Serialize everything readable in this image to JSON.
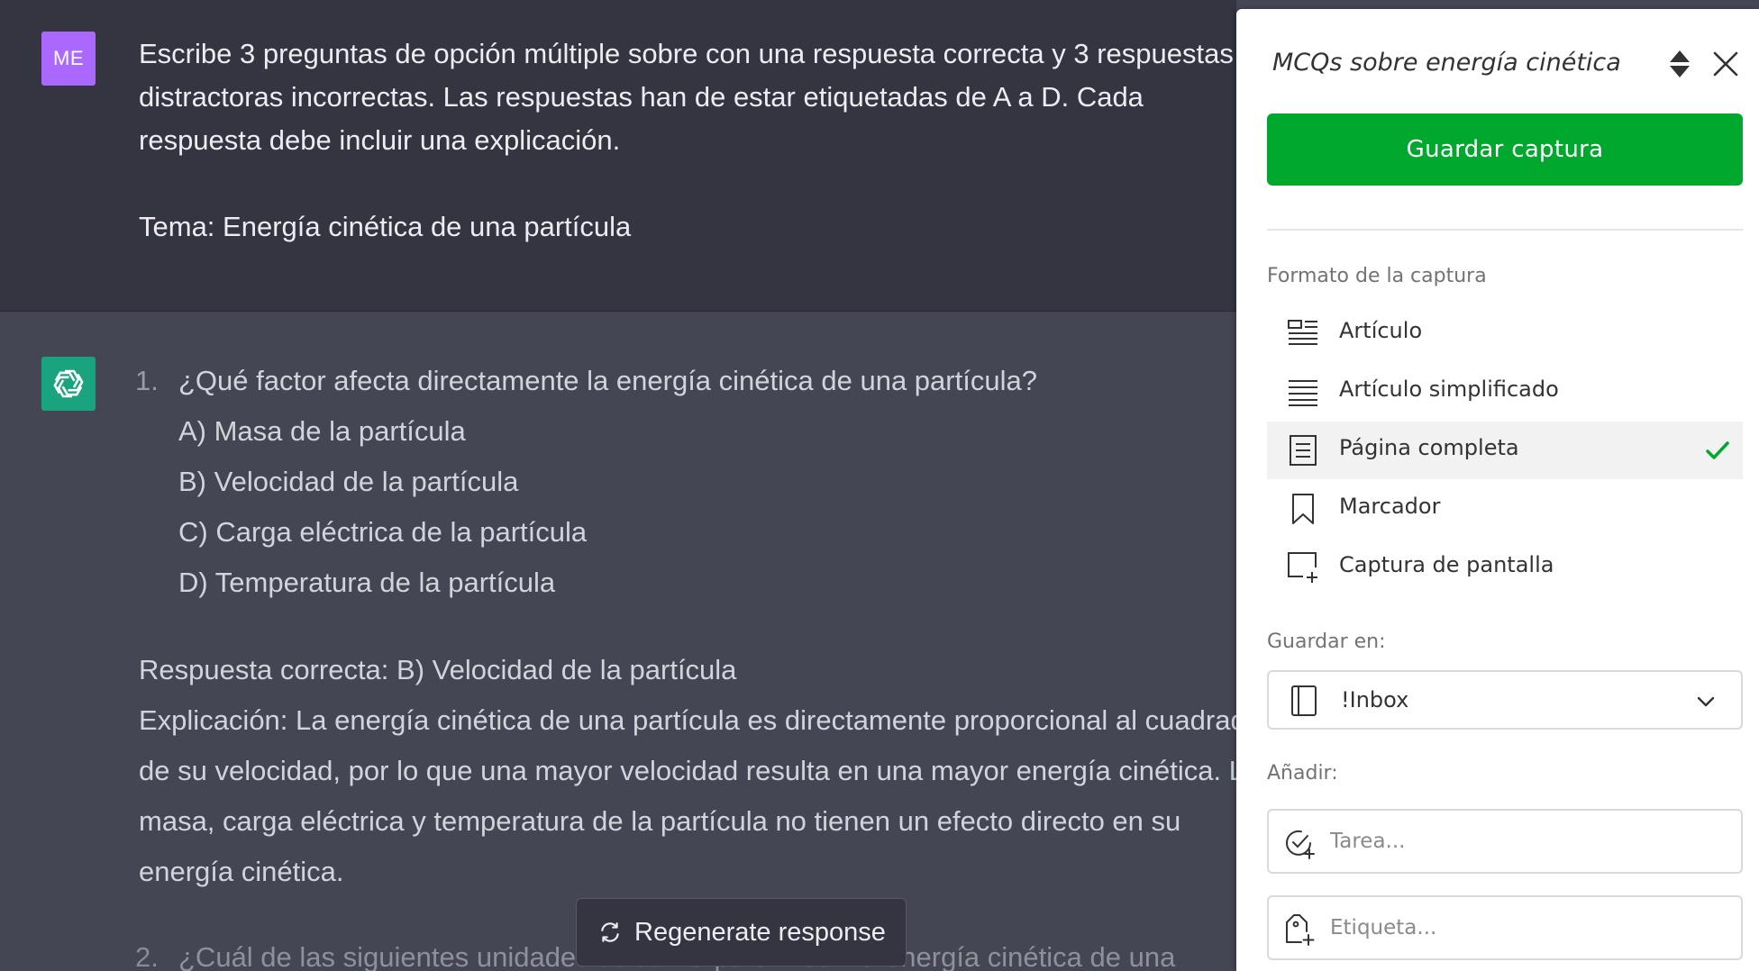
{
  "user": {
    "avatar_initials": "ME",
    "prompt_line1": "Escribe 3 preguntas de opción múltiple sobre con una respuesta correcta y 3 respuestas",
    "prompt_line2": "distractoras incorrectas. Las respuestas han de estar etiquetadas de A a D. Cada",
    "prompt_line3": "respuesta debe incluir una explicación.",
    "topic": "Tema: Energía cinética de una partícula"
  },
  "assistant": {
    "avatar_icon": "openai-logo-icon",
    "question1": {
      "number": "1.",
      "text": "¿Qué factor afecta directamente la energía cinética de una partícula?",
      "options": [
        "A) Masa de la partícula",
        "B) Velocidad de la partícula",
        "C) Carga eléctrica de la partícula",
        "D) Temperatura de la partícula"
      ],
      "correct": "Respuesta correcta: B) Velocidad de la partícula",
      "explanation_lines": [
        "Explicación: La energía cinética de una partícula es directamente proporcional al cuadrado",
        "de su velocidad, por lo que una mayor velocidad resulta en una mayor energía cinética. La",
        "masa, carga eléctrica y temperatura de la partícula no tienen un efecto directo en su",
        "energía cinética."
      ]
    },
    "question2": {
      "number": "2.",
      "text_partial": "¿Cuál de las siguientes unidades se utiliza para medir la energía cinética de una"
    },
    "regenerate_label": "Regenerate response"
  },
  "clipper": {
    "title": "MCQs sobre energía cinética",
    "save_button": "Guardar captura",
    "format_label": "Formato de la captura",
    "formats": [
      {
        "label": "Artículo",
        "icon": "article-icon"
      },
      {
        "label": "Artículo simplificado",
        "icon": "simplified-article-icon"
      },
      {
        "label": "Página completa",
        "icon": "full-page-icon",
        "selected": true
      },
      {
        "label": "Marcador",
        "icon": "bookmark-icon"
      },
      {
        "label": "Captura de pantalla",
        "icon": "screenshot-icon"
      }
    ],
    "save_in_label": "Guardar en:",
    "notebook": "!Inbox",
    "add_label": "Añadir:",
    "task_placeholder": "Tarea...",
    "tag_placeholder": "Etiqueta...",
    "colors": {
      "accent": "#00a82d",
      "check": "#00a82d"
    }
  },
  "colors": {
    "user_bg": "#343541",
    "assistant_bg": "#444654",
    "user_avatar": "#ab68ff",
    "gpt_avatar": "#19a37f"
  }
}
